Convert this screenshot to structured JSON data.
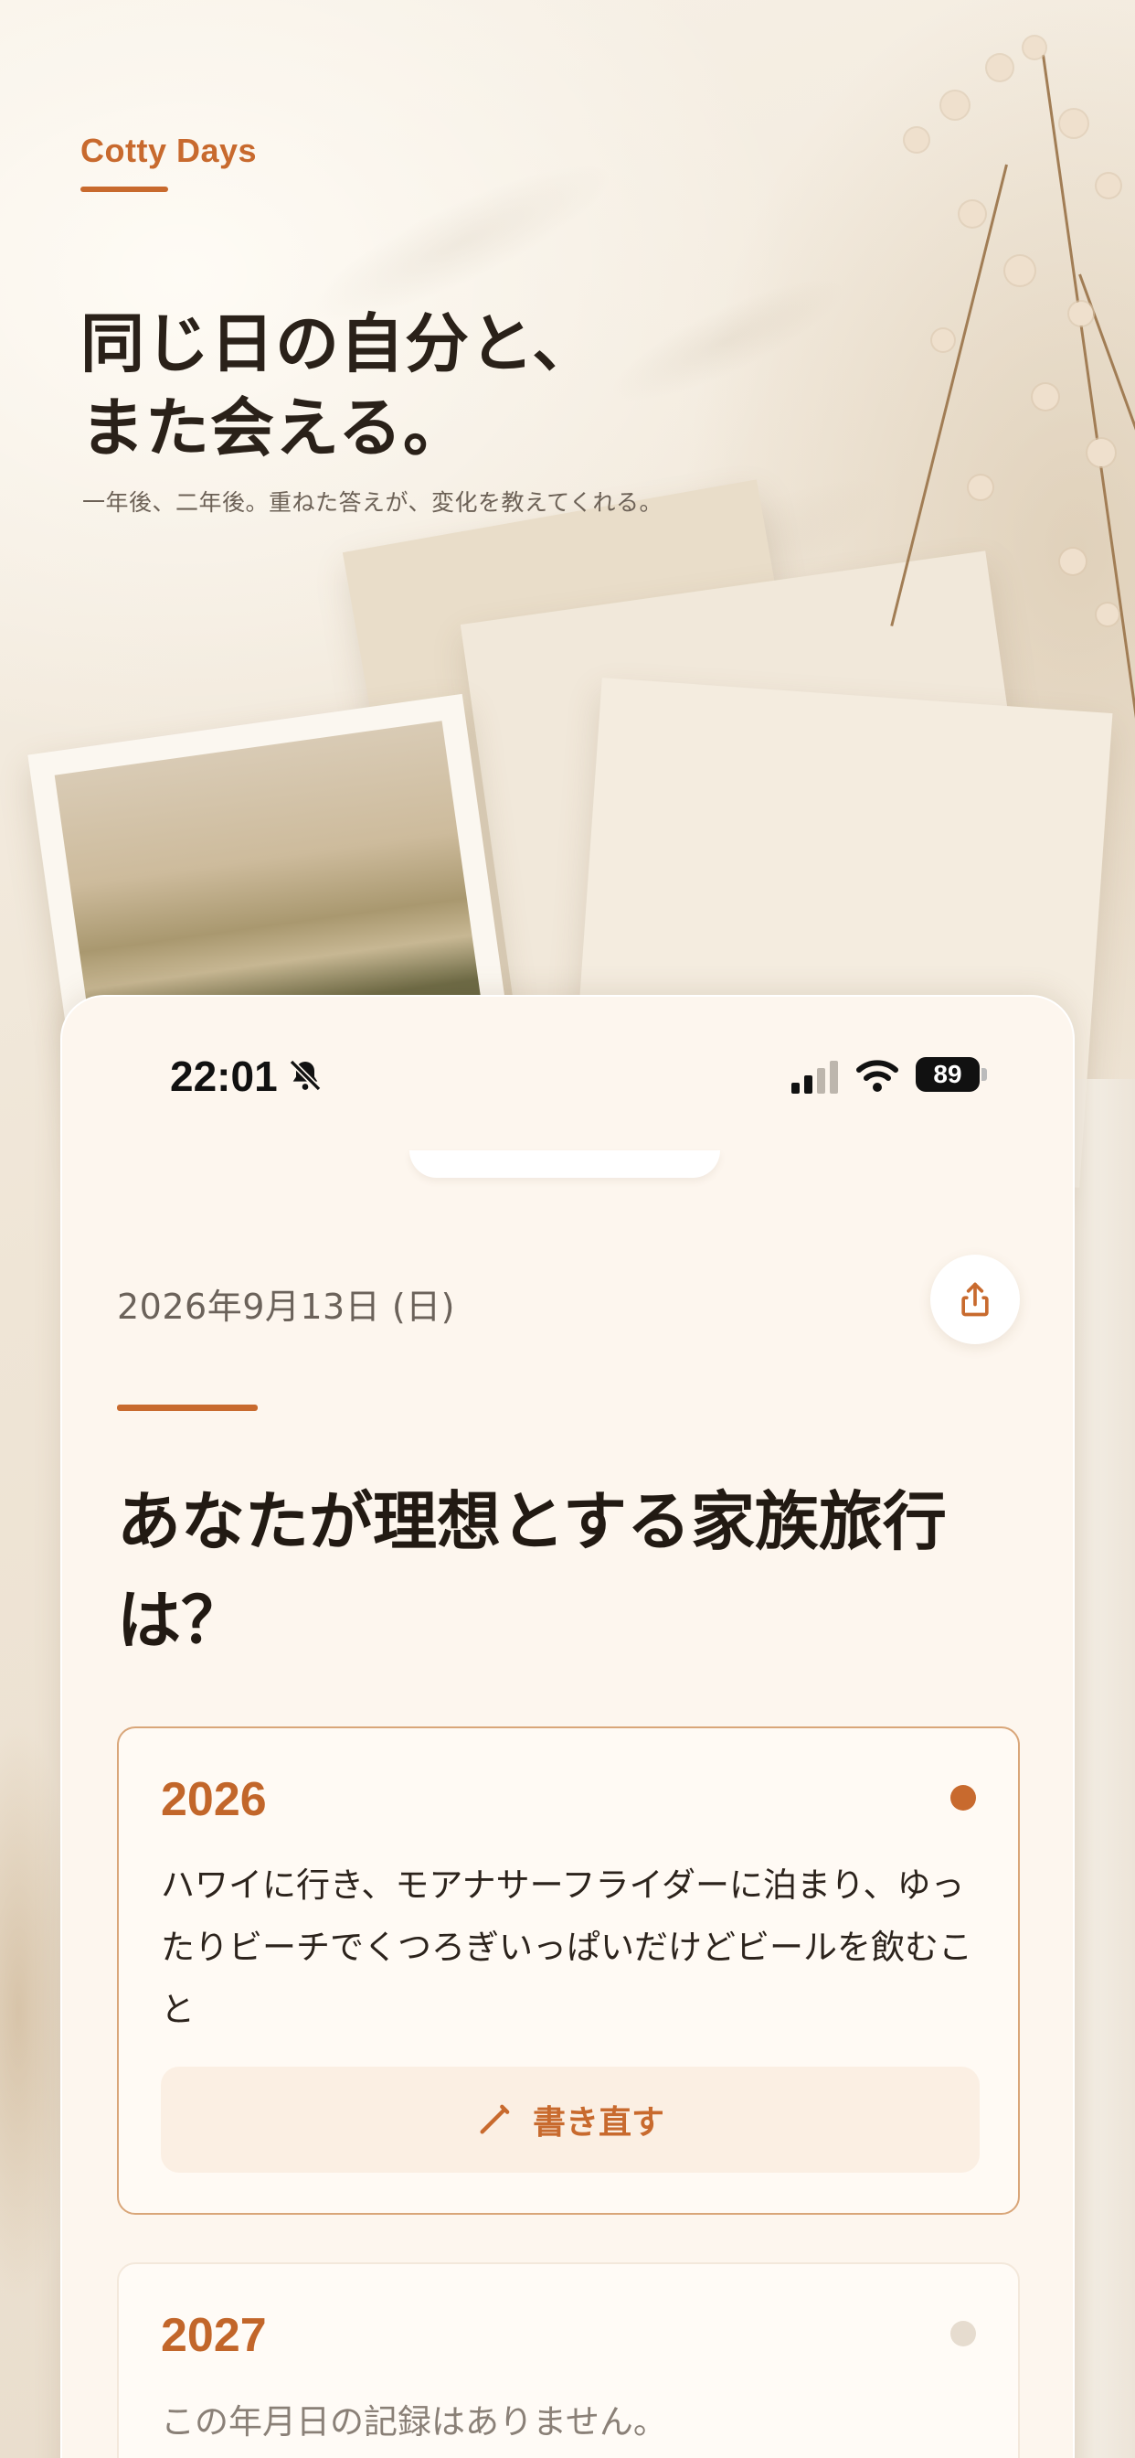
{
  "hero": {
    "brand": "Cotty Days",
    "headline_line1": "同じ日の自分と、",
    "headline_line2": "また会える。",
    "subline": "一年後、二年後。重ねた答えが、変化を教えてくれる。"
  },
  "status_bar": {
    "time": "22:01",
    "battery": "89",
    "icons": [
      "bell-slash-icon",
      "signal-icon",
      "wifi-icon",
      "battery-icon"
    ]
  },
  "screen": {
    "date": "2026年9月13日 (日)",
    "share_icon": "share-icon",
    "question": "あなたが理想とする家族旅行は？",
    "entries": [
      {
        "year": "2026",
        "text": "ハワイに行き、モアナサーフライダーに泊まり、ゆったりビーチでくつろぎいっぱいだけどビールを飲むこと",
        "button_label": "書き直す",
        "button_icon": "pencil-icon",
        "status": "active"
      },
      {
        "year": "2027",
        "text": "この年月日の記録はありません。",
        "status": "empty"
      }
    ]
  },
  "colors": {
    "accent": "#c86a2e",
    "card_background": "#fdf6ee",
    "text_primary": "#221a13"
  }
}
